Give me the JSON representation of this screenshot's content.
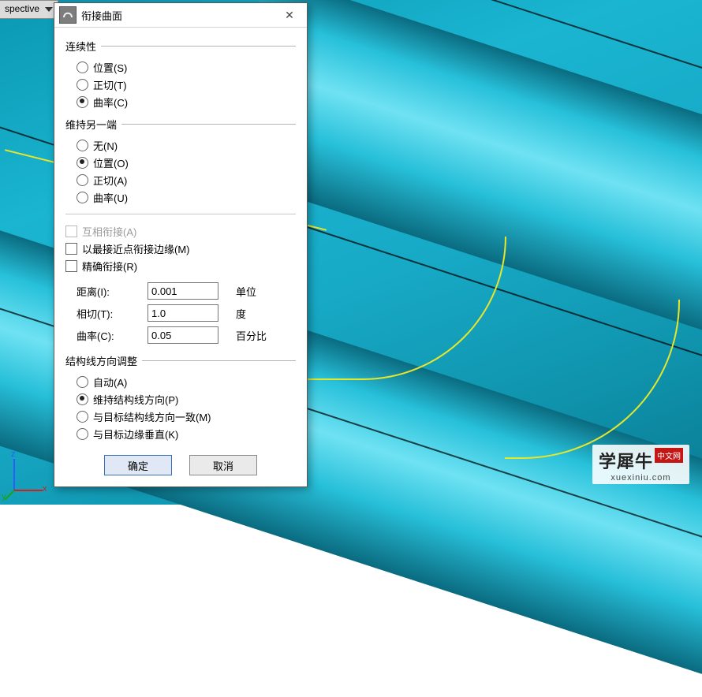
{
  "viewport_tab": "spective",
  "dialog": {
    "title": "衔接曲面",
    "continuity": {
      "legend": "连续性",
      "position": "位置(S)",
      "tangent": "正切(T)",
      "curvature": "曲率(C)",
      "selected": "curvature"
    },
    "other_end": {
      "legend": "维持另一端",
      "none": "无(N)",
      "position": "位置(O)",
      "tangent": "正切(A)",
      "curvature": "曲率(U)",
      "selected": "position"
    },
    "checks": {
      "mutual": "互相衔接(A)",
      "closest_edge": "以最接近点衔接边缘(M)",
      "precise": "精确衔接(R)",
      "mutual_disabled": true,
      "mutual_checked": false,
      "closest_checked": false,
      "precise_checked": false
    },
    "precision": {
      "distance_label": "距离(I):",
      "distance_value": "0.001",
      "distance_unit": "单位",
      "tangent_label": "相切(T):",
      "tangent_value": "1.0",
      "tangent_unit": "度",
      "curvature_label": "曲率(C):",
      "curvature_value": "0.05",
      "curvature_unit": "百分比"
    },
    "iso": {
      "legend": "结构线方向调整",
      "auto": "自动(A)",
      "preserve": "维持结构线方向(P)",
      "match_target": "与目标结构线方向一致(M)",
      "perp_target": "与目标边缘垂直(K)",
      "selected": "preserve"
    },
    "buttons": {
      "ok": "确定",
      "cancel": "取消"
    }
  },
  "axes": {
    "x": "x",
    "y": "y",
    "z": "z"
  },
  "watermark": {
    "text": "学犀牛",
    "tag": "中文网",
    "url": "xuexiniu.com"
  }
}
